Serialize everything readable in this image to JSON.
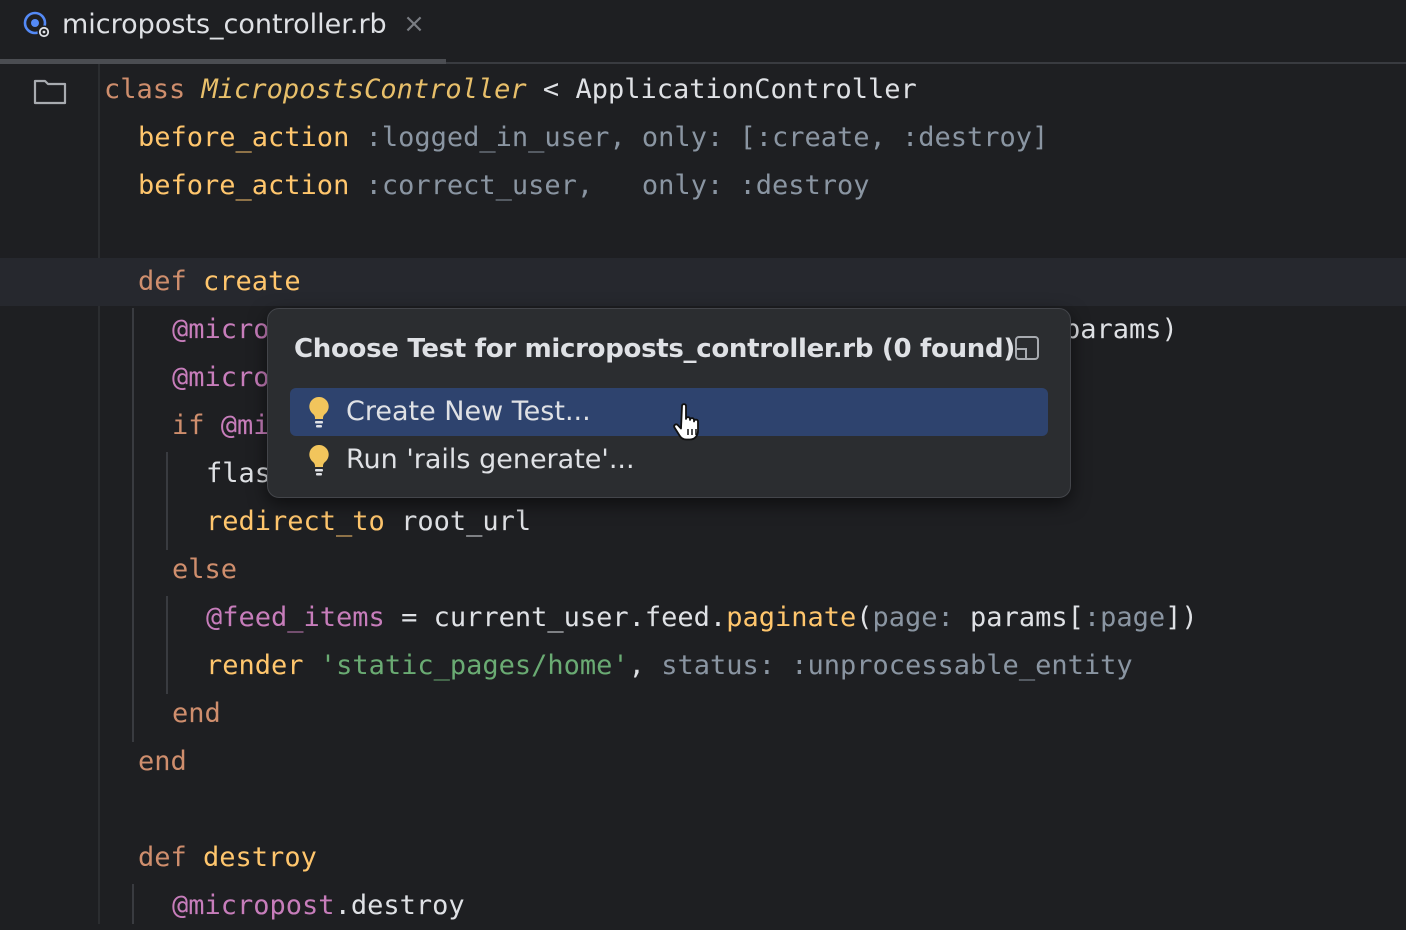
{
  "tab": {
    "filename": "microposts_controller.rb",
    "close_glyph": "×",
    "file_icon": "ruby-controller-icon"
  },
  "colors": {
    "background": "#1e1f22",
    "keyword": "#cf8e6d",
    "method": "#ffc66d",
    "instance_var": "#c77dbb",
    "string": "#6aab73",
    "selection": "#2e436e"
  },
  "code": {
    "l1": {
      "kw": "class",
      "cls": "MicropostsController",
      "op": " < ",
      "parent": "ApplicationController"
    },
    "l2": {
      "m": "before_action",
      "rest": " :logged_in_user, only: [:create, :destroy]"
    },
    "l3": {
      "m": "before_action",
      "rest": " :correct_user,   only: :destroy"
    },
    "l5": {
      "kw": "def",
      "name": " create"
    },
    "l6": {
      "ivar": "@micro",
      "tail": "params)"
    },
    "l7": {
      "ivar": "@micro"
    },
    "l8": {
      "kw": "if",
      "ivar": " @mi"
    },
    "l9": {
      "text": "flas"
    },
    "l10": {
      "m": "redirect_to",
      "rest": " root_url"
    },
    "l11": {
      "kw": "else"
    },
    "l12": {
      "ivar": "@feed_items",
      "eq": " = ",
      "call": "current_user.feed.",
      "m": "paginate",
      "args1": "(",
      "argk": "page:",
      "args2": " params[",
      "sym": ":page",
      "args3": "])"
    },
    "l13": {
      "m": "render",
      "sp": " ",
      "str": "'static_pages/home'",
      "comma": ", ",
      "key": "status:",
      "sym": " :unprocessable_entity"
    },
    "l14": {
      "kw": "end"
    },
    "l15": {
      "kw": "end"
    },
    "l17": {
      "kw": "def",
      "name": " destroy"
    },
    "l18": {
      "ivar": "@micropost",
      "rest": ".destroy"
    }
  },
  "popup": {
    "title": "Choose Test for microposts_controller.rb (0 found)",
    "items": [
      {
        "label": "Create New Test...",
        "icon": "lightbulb-icon",
        "selected": true
      },
      {
        "label": "Run 'rails generate'...",
        "icon": "lightbulb-icon",
        "selected": false
      }
    ]
  }
}
